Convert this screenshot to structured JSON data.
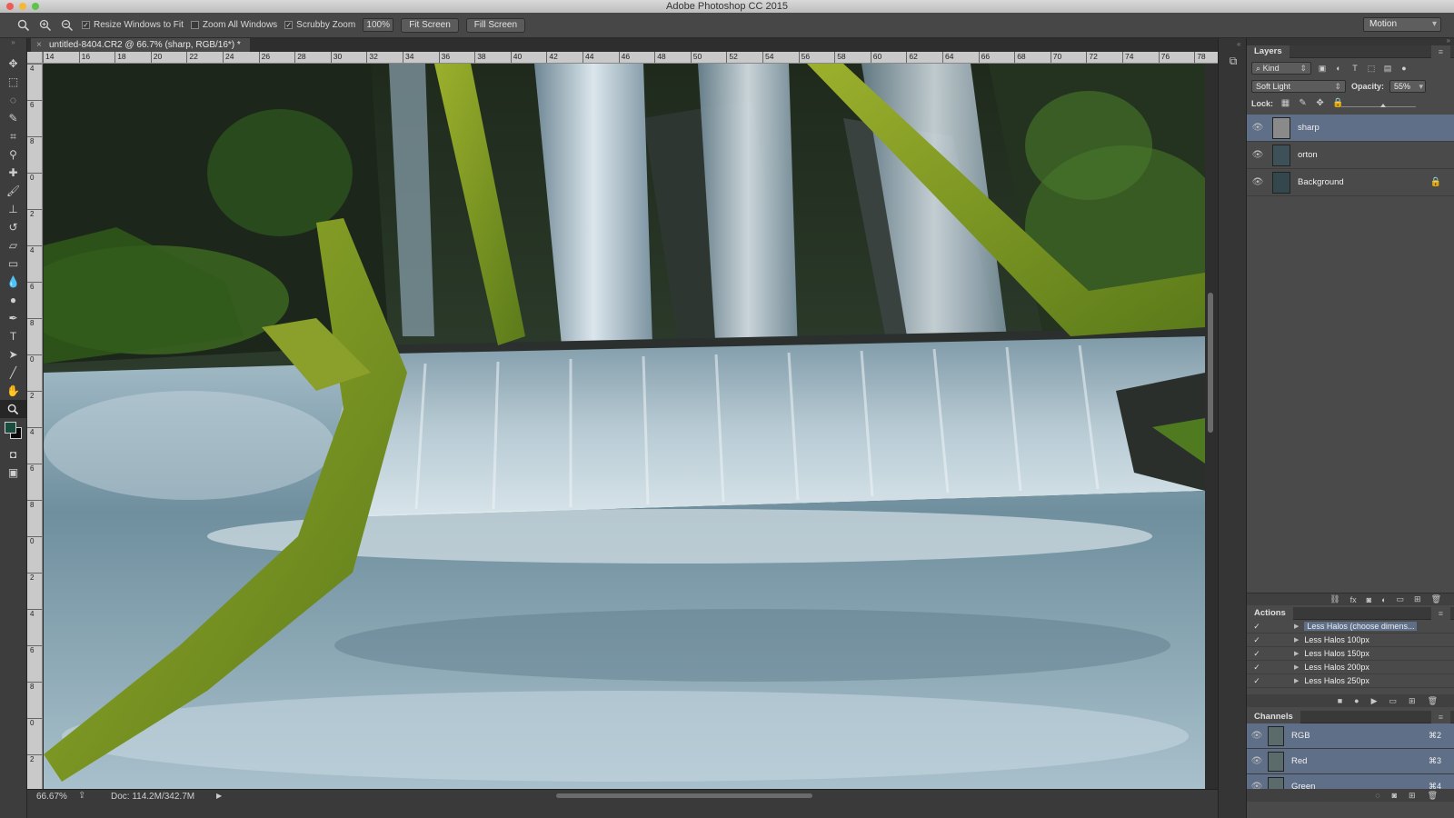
{
  "app": {
    "title": "Adobe Photoshop CC 2015"
  },
  "options_bar": {
    "resize_windows": "Resize Windows to Fit",
    "zoom_all": "Zoom All Windows",
    "scrubby": "Scrubby Zoom",
    "zoom_value": "100%",
    "fit_screen": "Fit Screen",
    "fill_screen": "Fill Screen",
    "workspace": "Motion"
  },
  "document": {
    "tab_title": "untitled-8404.CR2 @ 66.7% (sharp, RGB/16*) *",
    "close": "×",
    "ruler_h": [
      "14",
      "16",
      "18",
      "20",
      "22",
      "24",
      "26",
      "28",
      "30",
      "32",
      "34",
      "36",
      "38",
      "40",
      "42",
      "44",
      "46",
      "48",
      "50",
      "52",
      "54",
      "56",
      "58",
      "60",
      "62",
      "64",
      "66",
      "68",
      "70",
      "72",
      "74",
      "76",
      "78"
    ],
    "ruler_v": [
      "4",
      "6",
      "8",
      "0",
      "2",
      "4",
      "6",
      "8",
      "0",
      "2",
      "4",
      "6",
      "8",
      "0",
      "2",
      "4",
      "6",
      "8",
      "0",
      "2"
    ]
  },
  "status_bar": {
    "zoom": "66.67%",
    "doc": "Doc: 114.2M/342.7M"
  },
  "layers_panel": {
    "title": "Layers",
    "filter": "Kind",
    "blend_mode": "Soft Light",
    "opacity_label": "Opacity:",
    "opacity": "55%",
    "opacity_fraction": 0.55,
    "lock_label": "Lock:",
    "layers": [
      {
        "name": "sharp",
        "selected": true,
        "locked": false
      },
      {
        "name": "orton",
        "selected": false,
        "locked": false
      },
      {
        "name": "Background",
        "selected": false,
        "locked": true
      }
    ]
  },
  "actions_panel": {
    "title": "Actions",
    "items": [
      {
        "name": "Less Halos (choose dimens...",
        "selected": true
      },
      {
        "name": "Less Halos 100px",
        "selected": false
      },
      {
        "name": "Less Halos 150px",
        "selected": false
      },
      {
        "name": "Less Halos 200px",
        "selected": false
      },
      {
        "name": "Less Halos 250px",
        "selected": false
      }
    ]
  },
  "channels_panel": {
    "title": "Channels",
    "items": [
      {
        "name": "RGB",
        "shortcut": "⌘2"
      },
      {
        "name": "Red",
        "shortcut": "⌘3"
      },
      {
        "name": "Green",
        "shortcut": "⌘4"
      }
    ]
  },
  "colors": {
    "foreground": "#1b4d3e",
    "background": "#0a0a0a",
    "selection": "#5f6f88"
  }
}
